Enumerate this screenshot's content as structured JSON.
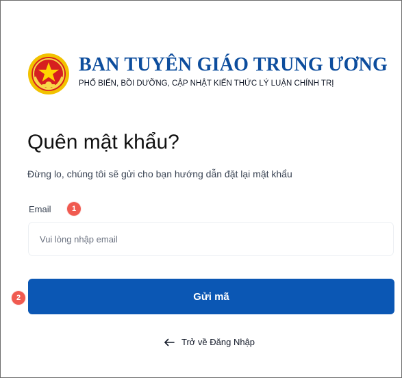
{
  "header": {
    "title": "BAN TUYÊN GIÁO TRUNG ƯƠNG",
    "subtitle": "PHỔ BIẾN, BỒI DƯỠNG, CẬP NHẬT KIẾN THỨC LÝ LUẬN CHÍNH TRỊ",
    "logo_icon": "national-emblem-icon"
  },
  "form": {
    "heading": "Quên mật khẩu?",
    "description": "Đừng lo, chúng tôi sẽ gửi cho bạn hướng dẫn đặt lại mật khẩu",
    "email_label": "Email",
    "email_value": "",
    "email_placeholder": "Vui lòng nhập email",
    "submit_label": "Gửi mã",
    "back_label": "Trở về Đăng Nhập",
    "back_icon": "arrow-left-icon"
  },
  "annotations": {
    "marker_1": "1",
    "marker_2": "2",
    "color": "#f05a50"
  },
  "colors": {
    "brand": "#0d4d9d",
    "button": "#0b57b4",
    "border": "#6b6b6b"
  }
}
